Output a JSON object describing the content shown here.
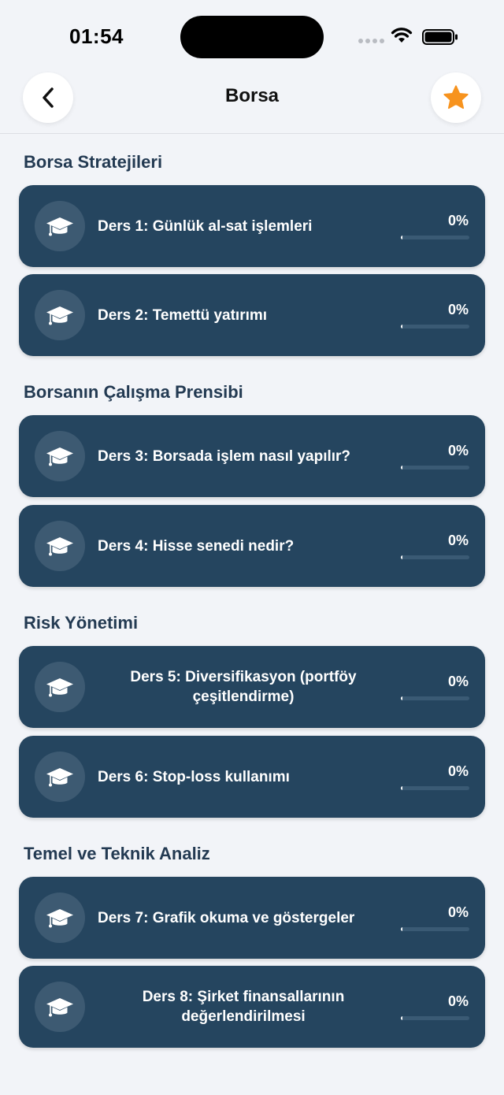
{
  "status_bar": {
    "time": "01:54"
  },
  "nav": {
    "title": "Borsa",
    "back_icon": "chevron-left-icon",
    "favorite_icon": "star-icon",
    "favorite_color": "#f7931e"
  },
  "colors": {
    "card_bg": "#25455f",
    "section_title": "#233a52",
    "page_bg": "#f2f4f8"
  },
  "sections": [
    {
      "title": "Borsa Stratejileri",
      "lessons": [
        {
          "title": "Ders 1: Günlük al-sat işlemleri",
          "progress_label": "0%",
          "progress": 0
        },
        {
          "title": "Ders 2: Temettü yatırımı",
          "progress_label": "0%",
          "progress": 0
        }
      ]
    },
    {
      "title": "Borsanın Çalışma Prensibi",
      "lessons": [
        {
          "title": "Ders 3: Borsada işlem nasıl yapılır?",
          "progress_label": "0%",
          "progress": 0
        },
        {
          "title": "Ders 4: Hisse senedi nedir?",
          "progress_label": "0%",
          "progress": 0
        }
      ]
    },
    {
      "title": "Risk Yönetimi",
      "lessons": [
        {
          "title": "Ders 5: Diversifikasyon (portföy çeşitlendirme)",
          "progress_label": "0%",
          "progress": 0
        },
        {
          "title": "Ders 6: Stop-loss kullanımı",
          "progress_label": "0%",
          "progress": 0
        }
      ]
    },
    {
      "title": "Temel ve Teknik Analiz",
      "lessons": [
        {
          "title": "Ders 7: Grafik okuma ve göstergeler",
          "progress_label": "0%",
          "progress": 0
        },
        {
          "title": "Ders 8: Şirket finansallarının değerlendirilmesi",
          "progress_label": "0%",
          "progress": 0
        }
      ]
    }
  ]
}
